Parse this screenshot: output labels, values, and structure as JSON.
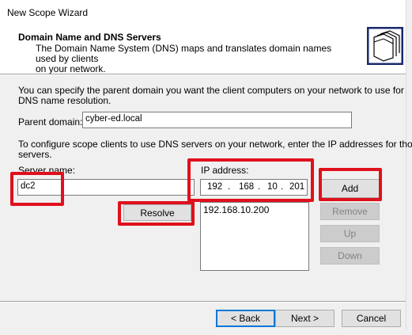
{
  "window": {
    "title": "New Scope Wizard"
  },
  "header": {
    "title": "Domain Name and DNS Servers",
    "description_line1": "The Domain Name System (DNS) maps and translates domain names used by clients",
    "description_line2": "on your network.",
    "icon": "folders-wizard-icon"
  },
  "intro": {
    "line1": "You can specify the parent domain you want the client computers on your network to use for",
    "line2": "DNS name resolution."
  },
  "parent_domain": {
    "label": "Parent domain:",
    "value": "cyber-ed.local"
  },
  "configure": {
    "line1": "To configure scope clients to use DNS servers on your network, enter the IP addresses for those",
    "line2": "servers."
  },
  "server_name": {
    "label": "Server name:",
    "value": "dc2"
  },
  "ip_address": {
    "label": "IP address:",
    "octets": [
      "192",
      "168",
      "10",
      "201"
    ],
    "dot": "."
  },
  "ip_list": {
    "items": [
      "192.168.10.200"
    ]
  },
  "buttons": {
    "resolve": "Resolve",
    "add": "Add",
    "remove": "Remove",
    "up": "Up",
    "down": "Down",
    "back": "< Back",
    "next": "Next >",
    "cancel": "Cancel"
  },
  "colors": {
    "highlight": "#e0101c",
    "dialog_bg": "#f0f0f0",
    "focus": "#0078d7"
  }
}
